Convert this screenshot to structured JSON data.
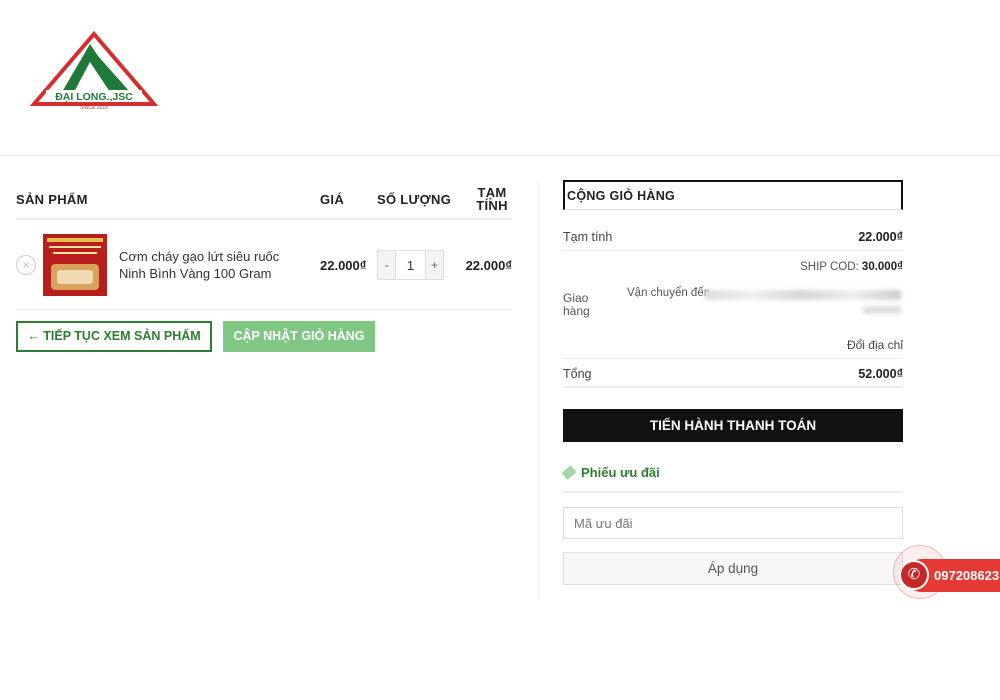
{
  "logo": {
    "text": "ĐẠI LONG.,JSC",
    "since": "SINCE 2010",
    "colors": {
      "green": "#1f7a3a",
      "red": "#d32f2f"
    }
  },
  "cart": {
    "headers": {
      "product": "SẢN PHẨM",
      "price": "GIÁ",
      "quantity": "SỐ LƯỢNG",
      "subtotal_line1": "TẠM",
      "subtotal_line2": "TÍNH"
    },
    "items": [
      {
        "remove_icon": "×",
        "name": "Cơm cháy gạo lứt siêu ruốc Ninh Bình Vàng 100 Gram",
        "price": "22.000₫",
        "quantity": "1",
        "minus": "-",
        "plus": "+",
        "subtotal": "22.000₫"
      }
    ],
    "continue_label": "← TIẾP TỤC XEM SẢN PHẨM",
    "update_label": "CẬP NHẬT GIỎ HÀNG"
  },
  "totals": {
    "title": "CỘNG GIỎ HÀNG",
    "subtotal_label": "Tạm tính",
    "subtotal_value": "22.000₫",
    "ship_cod_label": "SHIP COD:",
    "ship_cod_value": "30.000₫",
    "shipping_label_1": "Giao",
    "shipping_label_2": "hàng",
    "ship_to_label": "Vận chuyển đến",
    "change_address": "Đổi địa chỉ",
    "total_label": "Tổng",
    "total_value": "52.000₫",
    "checkout_label": "TIẾN HÀNH THANH TOÁN"
  },
  "coupon": {
    "title": "Phiếu ưu đãi",
    "placeholder": "Mã ưu đãi",
    "apply_label": "Áp dụng"
  },
  "hotline": {
    "icon": "phone-icon",
    "number": "097208623"
  }
}
